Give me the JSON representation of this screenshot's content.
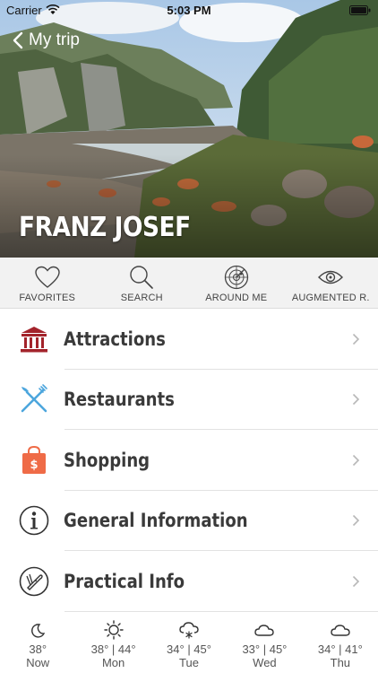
{
  "status": {
    "carrier": "Carrier",
    "time": "5:03 PM"
  },
  "nav": {
    "back_label": "My trip"
  },
  "hero": {
    "title": "FRANZ JOSEF"
  },
  "toolbar": [
    {
      "label": "FAVORITES",
      "icon": "heart-icon"
    },
    {
      "label": "SEARCH",
      "icon": "magnifier-icon"
    },
    {
      "label": "AROUND ME",
      "icon": "radar-icon"
    },
    {
      "label": "AUGMENTED R.",
      "icon": "eye-icon"
    }
  ],
  "menu": [
    {
      "label": "Attractions",
      "icon": "museum-icon",
      "color": "#a3232b"
    },
    {
      "label": "Restaurants",
      "icon": "fork-knife-icon",
      "color": "#4da6dd"
    },
    {
      "label": "Shopping",
      "icon": "shopping-bag-icon",
      "color": "#ef6b47"
    },
    {
      "label": "General Information",
      "icon": "info-icon",
      "color": "#333333"
    },
    {
      "label": "Practical Info",
      "icon": "swiss-knife-icon",
      "color": "#333333"
    }
  ],
  "weather": [
    {
      "temp": "38°",
      "day": "Now",
      "icon": "moon-icon"
    },
    {
      "temp": "38° | 44°",
      "day": "Mon",
      "icon": "sun-icon"
    },
    {
      "temp": "34° | 45°",
      "day": "Tue",
      "icon": "snow-cloud-icon"
    },
    {
      "temp": "33° | 45°",
      "day": "Wed",
      "icon": "cloud-icon"
    },
    {
      "temp": "34° | 41°",
      "day": "Thu",
      "icon": "cloud-icon"
    }
  ]
}
